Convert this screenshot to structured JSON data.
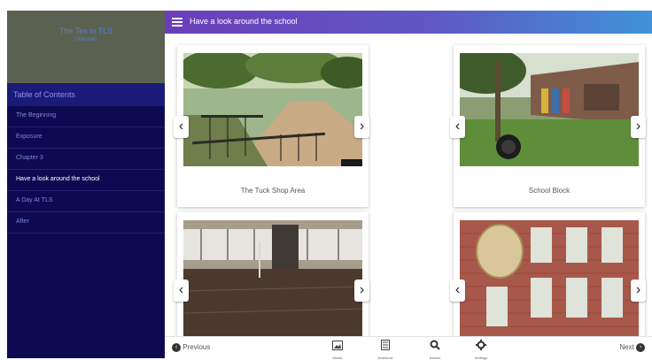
{
  "sidebar": {
    "book_title": "The Tes in TLS",
    "book_author": "Unknown",
    "toc_heading": "Table of Contents",
    "items": [
      {
        "label": "The Beginning"
      },
      {
        "label": "Exposure"
      },
      {
        "label": "Chapter 3"
      },
      {
        "label": "Have a look around the school"
      },
      {
        "label": "A Day At TLS"
      },
      {
        "label": "After"
      }
    ]
  },
  "topbar": {
    "title": "Have a look around the school"
  },
  "cards": [
    {
      "caption": "The Tuck Shop Area"
    },
    {
      "caption": "School Block"
    },
    {
      "caption": ""
    },
    {
      "caption": ""
    }
  ],
  "bottombar": {
    "previous": "Previous",
    "next": "Next",
    "tools": [
      {
        "label": "Media",
        "icon": "media-icon"
      },
      {
        "label": "Notebook",
        "icon": "notebook-icon"
      },
      {
        "label": "Search",
        "icon": "search-icon"
      },
      {
        "label": "Settings",
        "icon": "settings-icon"
      }
    ]
  },
  "colors": {
    "sidebar_bg": "#0d0a52",
    "header_bg": "#5b6150",
    "topbar_start": "#6b3db8",
    "topbar_end": "#3f93d6"
  }
}
